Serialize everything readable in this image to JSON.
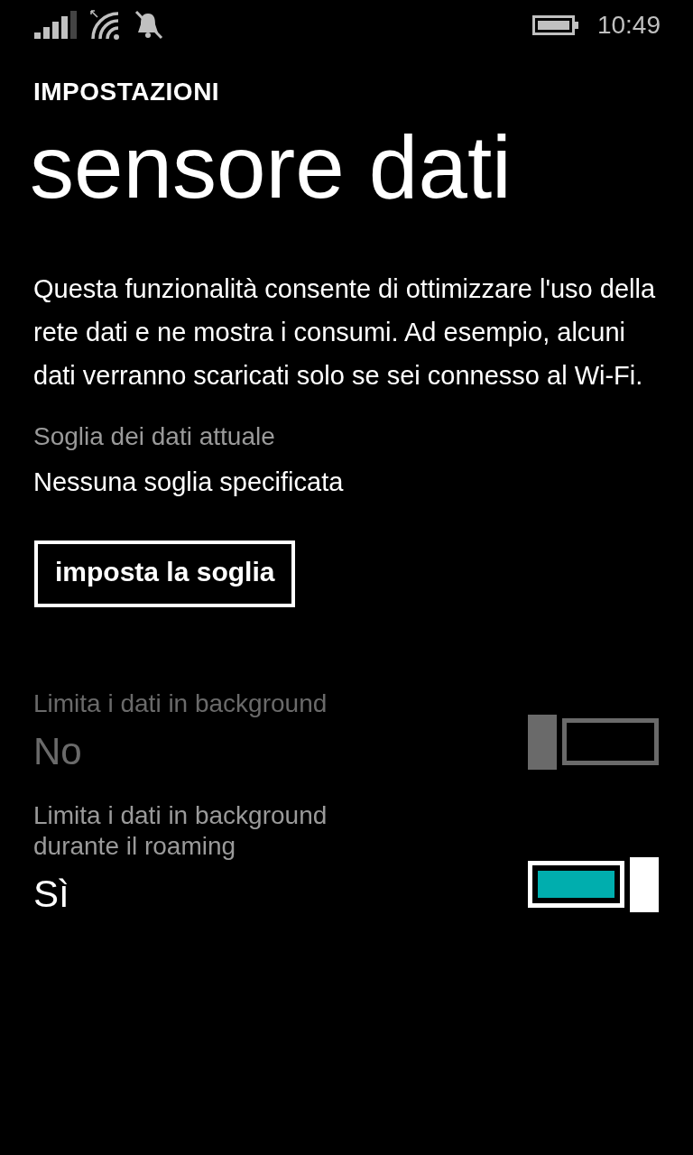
{
  "status_bar": {
    "time": "10:49"
  },
  "header": {
    "section": "IMPOSTAZIONI",
    "title": "sensore dati"
  },
  "description": "Questa funzionalità consente di ottimizzare l'uso della rete dati e ne mostra i consumi. Ad esempio, alcuni dati verranno scaricati solo se sei connesso al Wi-Fi.",
  "threshold": {
    "label": "Soglia dei dati attuale",
    "value": "Nessuna soglia specificata",
    "button": "imposta la soglia"
  },
  "toggles": [
    {
      "label": "Limita i dati in background",
      "value": "No",
      "on": false,
      "disabled": true
    },
    {
      "label": "Limita i dati in background durante il roaming",
      "value": "Sì",
      "on": true,
      "disabled": false
    }
  ]
}
